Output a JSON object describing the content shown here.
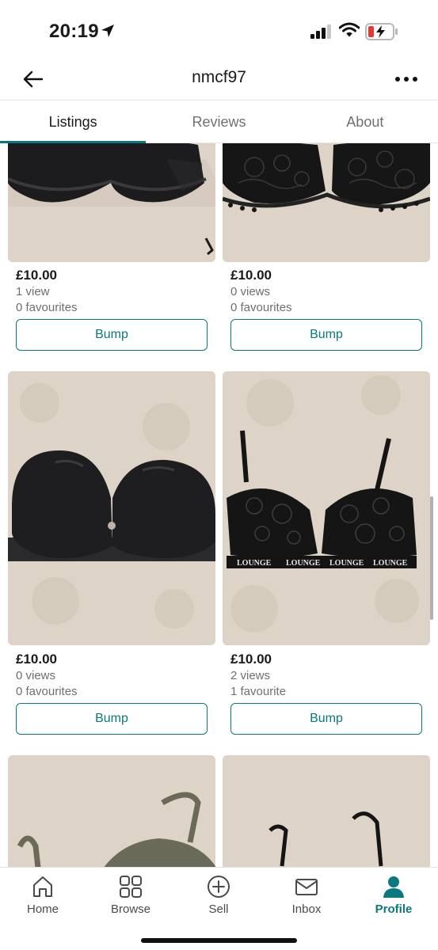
{
  "status_bar": {
    "time": "20:19"
  },
  "header": {
    "title": "nmcf97"
  },
  "tabs": [
    {
      "label": "Listings",
      "active": true
    },
    {
      "label": "Reviews",
      "active": false
    },
    {
      "label": "About",
      "active": false
    }
  ],
  "listings": [
    {
      "price": "£10.00",
      "views": "1 view",
      "favourites": "0 favourites",
      "action": "Bump"
    },
    {
      "price": "£10.00",
      "views": "0 views",
      "favourites": "0 favourites",
      "action": "Bump"
    },
    {
      "price": "£10.00",
      "views": "0 views",
      "favourites": "0 favourites",
      "action": "Bump"
    },
    {
      "price": "£10.00",
      "views": "2 views",
      "favourites": "1 favourite",
      "action": "Bump"
    },
    {
      "photo_text": "LOUNGE"
    }
  ],
  "bottom_nav": [
    {
      "label": "Home",
      "icon": "home-icon",
      "active": false
    },
    {
      "label": "Browse",
      "icon": "grid-icon",
      "active": false
    },
    {
      "label": "Sell",
      "icon": "plus-circle-icon",
      "active": false
    },
    {
      "label": "Inbox",
      "icon": "mail-icon",
      "active": false
    },
    {
      "label": "Profile",
      "icon": "person-icon",
      "active": true
    }
  ],
  "colors": {
    "accent": "#09797e",
    "muted_text": "#6f6f6f",
    "photo_background": "#ddd3c6"
  }
}
